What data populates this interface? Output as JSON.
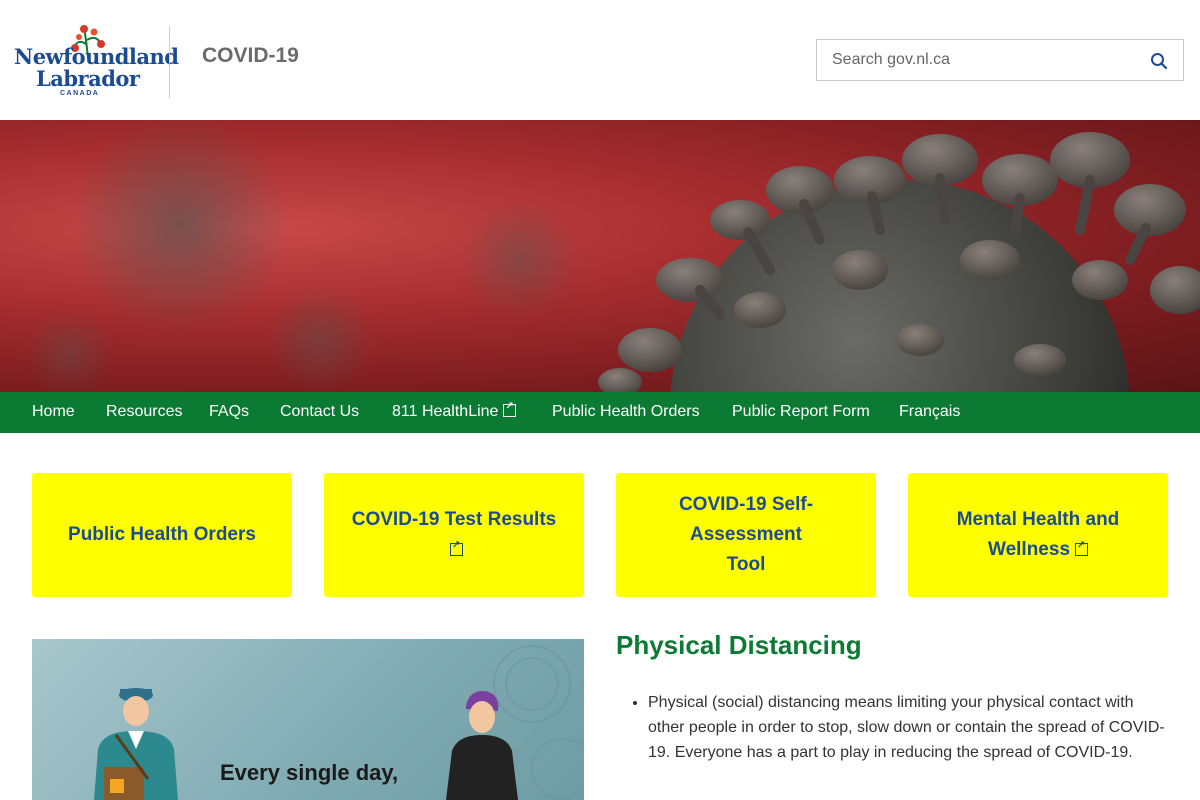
{
  "header": {
    "logo": {
      "line1": "Newfoundland",
      "line2": "Labrador",
      "line3": "CANADA"
    },
    "site_title": "COVID-19",
    "search": {
      "placeholder": "Search gov.nl.ca",
      "value": "",
      "icon": "search-icon"
    }
  },
  "nav": {
    "items": [
      {
        "label": "Home"
      },
      {
        "label": "Resources"
      },
      {
        "label": "FAQs"
      },
      {
        "label": "Contact Us"
      },
      {
        "label": "811 HealthLine",
        "external": true
      },
      {
        "label": "Public Health Orders"
      },
      {
        "label": "Public Report Form"
      },
      {
        "label": "Français"
      }
    ]
  },
  "tiles": [
    {
      "label": "Public Health Orders"
    },
    {
      "label": "COVID-19 Test Results",
      "external": true
    },
    {
      "label": "COVID-19 Self-Assessment Tool"
    },
    {
      "label": "Mental Health and Wellness",
      "external": true
    }
  ],
  "feature_image": {
    "caption": "Every single day,"
  },
  "article": {
    "title": "Physical Distancing",
    "bullets": [
      "Physical (social) distancing means limiting your physical contact with other people in order to stop, slow down or contain the spread of COVID-19. Everyone has a part to play in reducing the spread of COVID-19."
    ]
  },
  "colors": {
    "nav_green": "#0b7a32",
    "tile_yellow": "#ffff00",
    "brand_blue": "#1b4b93"
  }
}
